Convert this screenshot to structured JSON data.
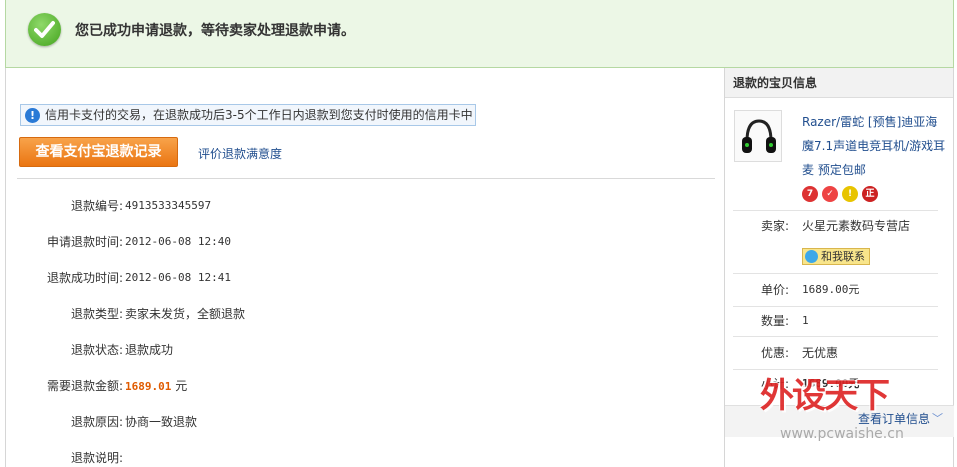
{
  "banner": {
    "message": "您已成功申请退款，等待卖家处理退款申请。",
    "icon": "check-circle-icon"
  },
  "main": {
    "notice": "信用卡支付的交易，在退款成功后3-5个工作日内退款到您支付时使用的信用卡中",
    "view_alipay_button": "查看支付宝退款记录",
    "rate_link": "评价退款满意度",
    "details": [
      {
        "label": "退款编号:",
        "value": "4913533345597"
      },
      {
        "label": "申请退款时间:",
        "value": "2012-06-08 12:40"
      },
      {
        "label": "退款成功时间:",
        "value": "2012-06-08 12:41"
      },
      {
        "label": "退款类型:",
        "value": "卖家未发货，全额退款"
      },
      {
        "label": "退款状态:",
        "value": "退款成功"
      },
      {
        "label": "需要退款金额:",
        "value": "1689.01",
        "unit": "元"
      },
      {
        "label": "退款原因:",
        "value": "协商一致退款"
      },
      {
        "label": "退款说明:",
        "value": ""
      }
    ]
  },
  "side": {
    "title": "退款的宝贝信息",
    "product_title": "Razer/雷蛇 [预售]迪亚海魔7.1声道电竞耳机/游戏耳麦 预定包邮",
    "seller_label": "卖家:",
    "seller_name": "火星元素数码专营店",
    "contact_button": "和我联系",
    "unit_price_label": "单价:",
    "unit_price": "1689.00元",
    "quantity_label": "数量:",
    "quantity": "1",
    "discount_label": "优惠:",
    "discount": "无优惠",
    "subtotal_label": "小计:",
    "subtotal": "1689.00元",
    "order_link": "查看订单信息"
  },
  "watermark": {
    "logo_text": "外设天下",
    "url": "www.pcwaishe.cn"
  },
  "colors": {
    "banner_bg": "#ecf7e6",
    "accent_orange": "#ea7512",
    "link_blue": "#224f8f",
    "amount_orange": "#e05b00"
  }
}
